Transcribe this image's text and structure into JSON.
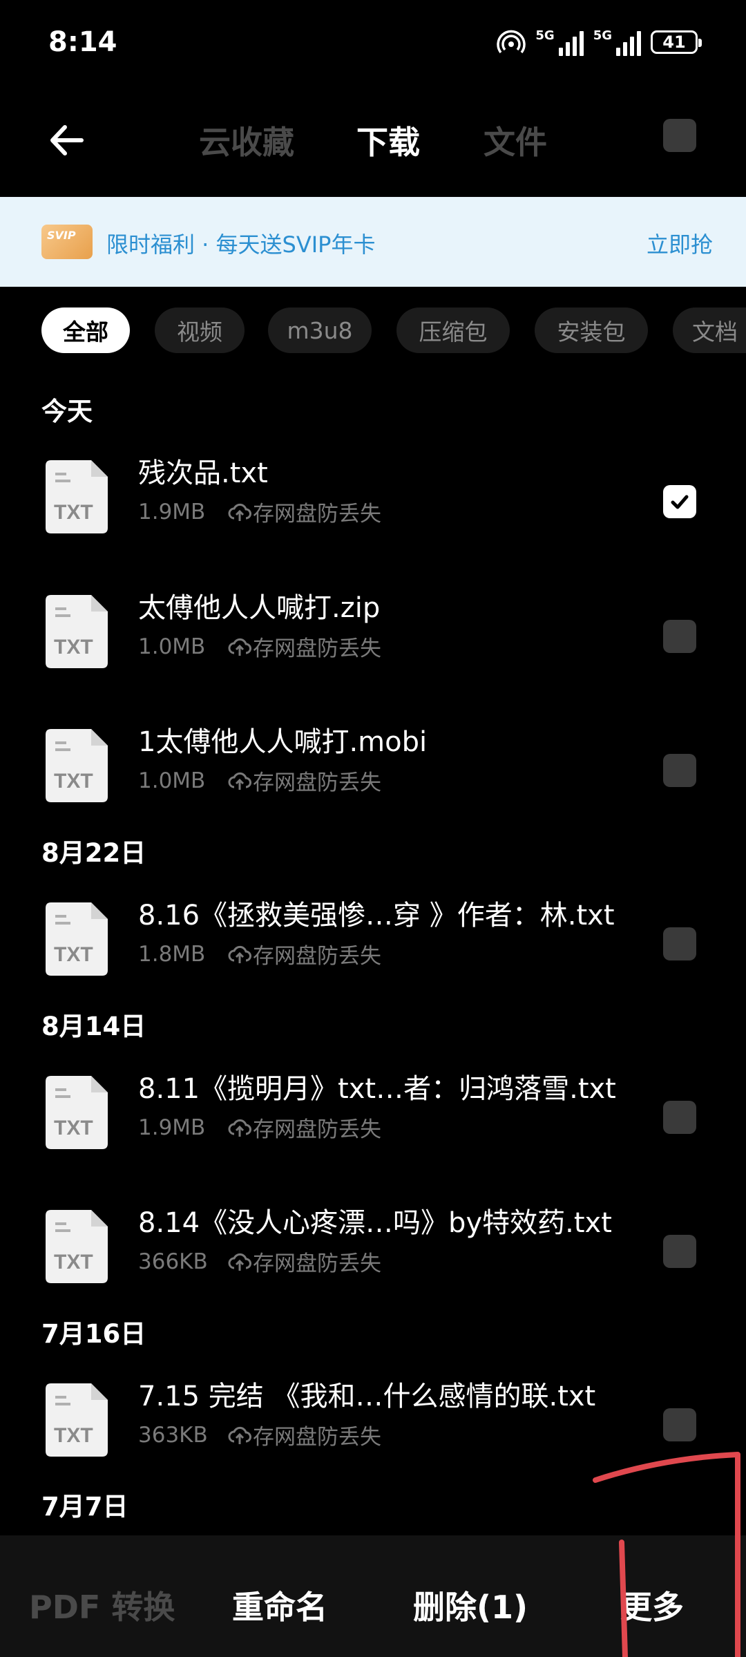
{
  "status_bar": {
    "time": "8:14",
    "battery": "41",
    "sim1": "5G",
    "sim2": "5G",
    "hotspot_count": "1"
  },
  "header": {
    "tabs": [
      "云收藏",
      "下载",
      "文件"
    ],
    "active_tab": "下载"
  },
  "banner": {
    "badge": "SVIP",
    "message": "限时福利 · 每天送SVIP年卡",
    "cta": "立即抢"
  },
  "filters": [
    "全部",
    "视频",
    "m3u8",
    "压缩包",
    "安装包",
    "文档"
  ],
  "cloud_label": "存网盘防丢失",
  "file_type_label": "TXT",
  "sections": [
    {
      "title": "今天",
      "files": [
        {
          "name": "残次品.txt",
          "size": "1.9MB",
          "checked": true
        },
        {
          "name": "太傅他人人喊打.zip",
          "size": "1.0MB",
          "checked": false
        },
        {
          "name": "1太傅他人人喊打.mobi",
          "size": "1.0MB",
          "checked": false
        }
      ]
    },
    {
      "title": "8月22日",
      "files": [
        {
          "name": "8.16《拯救美强惨…穿 》作者：林.txt",
          "size": "1.8MB",
          "checked": false
        }
      ]
    },
    {
      "title": "8月14日",
      "files": [
        {
          "name": "8.11《揽明月》txt…者：归鸿落雪.txt",
          "size": "1.9MB",
          "checked": false
        },
        {
          "name": "8.14《没人心疼漂…吗》by特效药.txt",
          "size": "366KB",
          "checked": false
        }
      ]
    },
    {
      "title": "7月16日",
      "files": [
        {
          "name": "7.15 完结 《我和…什么感情的联.txt",
          "size": "363KB",
          "checked": false
        }
      ]
    },
    {
      "title": "7月7日",
      "files": []
    }
  ],
  "bottom_bar": {
    "pdf": "PDF 转换",
    "rename": "重命名",
    "delete": "删除(1)",
    "more": "更多"
  },
  "colors": {
    "accent": "#2b8fd1",
    "banner_bg": "#e8f4fb",
    "annotation": "#e0484e"
  }
}
